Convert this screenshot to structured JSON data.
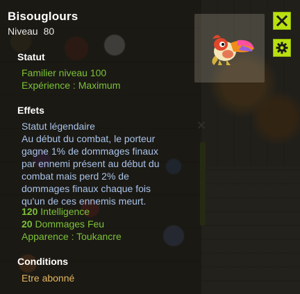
{
  "item": {
    "name": "Bisouglours",
    "level_label": "Niveau",
    "level_value": "80"
  },
  "statut": {
    "title": "Statut",
    "lines": [
      "Familier niveau 100",
      "Expérience : Maximum"
    ]
  },
  "effets": {
    "title": "Effets",
    "heading": "Statut légendaire",
    "description": "Au début du combat, le porteur\ngagne 1% de dommages finaux\npar ennemi présent au début du\ncombat mais perd 2% de\ndommages finaux chaque fois\nqu'un de ces ennemis meurt.",
    "stats": [
      {
        "value": "120",
        "label": "Intelligence"
      },
      {
        "value": "20",
        "label": "Dommages Feu"
      }
    ],
    "appearance": "Apparence : Toukancre"
  },
  "conditions": {
    "title": "Conditions",
    "line": "Etre abonné"
  },
  "icons": {
    "close": "close-icon",
    "settings": "gear-icon",
    "pet": "toucan-pet-icon"
  },
  "colors": {
    "accent": "#b9e10f",
    "green_text": "#7cc238",
    "blue_text": "#a9c4ea",
    "gold_text": "#e6b860"
  }
}
